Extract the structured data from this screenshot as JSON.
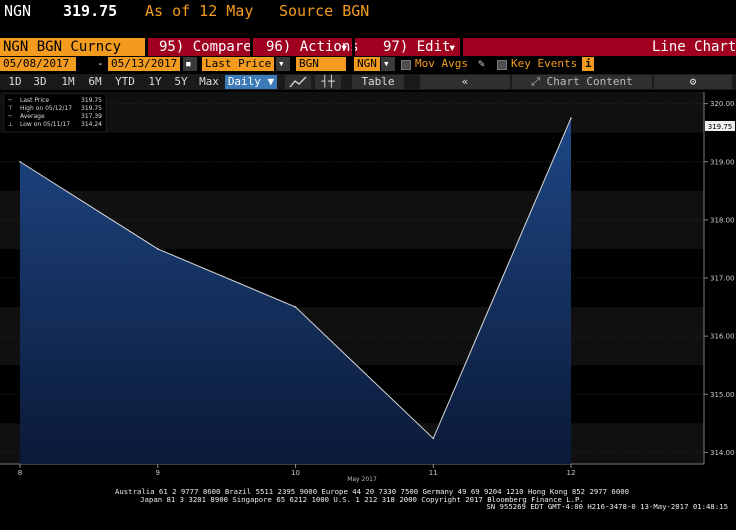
{
  "header": {
    "ticker": "NGN",
    "price": "319.75",
    "as_of": "As of 12 May",
    "source": "Source BGN"
  },
  "function_bar": {
    "security_title": "NGN BGN Curncy",
    "compare": "95) Compare",
    "actions": "96) Actions",
    "edit": "97) Edit",
    "chart_type": "Line Chart",
    "dropdown_glyph": "▾"
  },
  "params": {
    "start_date": "05/08/2017",
    "dash": "-",
    "end_date": "05/13/2017",
    "field": "Last Price",
    "source": "BGN",
    "currency": "NGN",
    "mov_avgs": "Mov Avgs",
    "key_events": "Key Events",
    "info_icon_label": "i"
  },
  "range_bar": {
    "buttons": [
      "1D",
      "3D",
      "1M",
      "6M",
      "YTD",
      "1Y",
      "5Y",
      "Max"
    ],
    "frequency": "Daily ▼",
    "table": "Table",
    "collapse": "«",
    "chart_content": "Chart Content",
    "gear_icon": "⚙"
  },
  "colors": {
    "amber": "#f39b1e",
    "function_bar": "#a0001f",
    "area_fill_top": "#1f4a8c",
    "area_fill_bottom": "#0b1a3a",
    "line": "#d9d9d9",
    "selected": "#3d7ab8"
  },
  "chart_data": {
    "type": "area",
    "x": [
      "8",
      "9",
      "10",
      "11",
      "12"
    ],
    "xlabel": "May 2017",
    "series": [
      {
        "name": "Last Price",
        "values": [
          319.0,
          317.5,
          316.5,
          314.24,
          319.75
        ]
      }
    ],
    "ylim": [
      313.8,
      320.2
    ],
    "yticks": [
      "314.00",
      "315.00",
      "316.00",
      "317.00",
      "318.00",
      "319.00",
      "320.00"
    ],
    "last_value_label": "319.75",
    "legend": [
      {
        "label": "Last Price",
        "value": "319.75"
      },
      {
        "label": "High on 05/12/17",
        "value": "319.75"
      },
      {
        "label": "Average",
        "value": "317.39"
      },
      {
        "label": "Low on 05/11/17",
        "value": "314.24"
      }
    ],
    "legend_position": "top-left",
    "grid": true
  },
  "footer": {
    "line1": "Australia 61 2 9777 8600 Brazil 5511 2395 9000 Europe 44 20 7330 7500 Germany 49 69 9204 1210 Hong Kong 852 2977 6000",
    "line2": "Japan 81 3 3201 8900         Singapore 65 6212 1000        U.S. 1 212 318 2000          Copyright 2017 Bloomberg Finance L.P.",
    "line3": "SN 955269 EDT  GMT-4:00 H216-3478-0 13-May-2017 01:48:15"
  }
}
